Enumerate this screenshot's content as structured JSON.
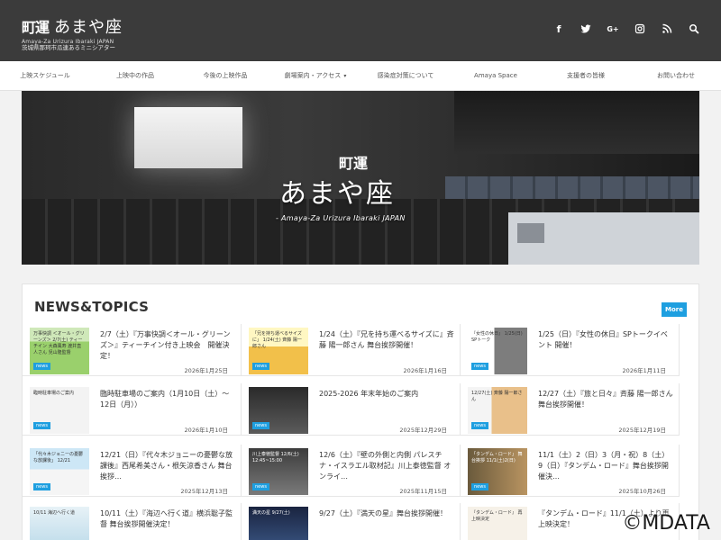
{
  "header": {
    "logo_mark": "町運",
    "logo_name": "あまや座",
    "logo_sub": "Amaya-Za Urizura Ibaraki JAPAN",
    "tagline": "茨城県那珂市瓜連あるミニシアター",
    "social_icons": [
      "facebook-icon",
      "twitter-icon",
      "google-plus-icon",
      "instagram-icon",
      "rss-icon",
      "search-icon"
    ]
  },
  "nav": {
    "items": [
      {
        "label": "上映スケジュール"
      },
      {
        "label": "上映中の作品"
      },
      {
        "label": "今後の上映作品"
      },
      {
        "label": "劇場案内・アクセス",
        "caret": "▾"
      },
      {
        "label": "感染症対策について"
      },
      {
        "label": "Amaya Space"
      },
      {
        "label": "支援者の皆様"
      },
      {
        "label": "お問い合わせ"
      }
    ]
  },
  "hero": {
    "mark": "町運",
    "name": "あまや座",
    "sub": "- Amaya-Za Urizura Ibaraki JAPAN"
  },
  "news": {
    "title": "NEWS&TOPICS",
    "more_label": "More",
    "tag_label": "news",
    "items": [
      {
        "title": "2/7（土）『万事快調＜オール・グリーンズ＞』ティーチイン付き上映会　開催決定！",
        "date": "2026年1月25日",
        "thumb_text": "万事快調 ＜オール・グリーンズ＞ 2/7(土) ティーチイン 大森風寿 渡井直人さん 児山隆監督"
      },
      {
        "title": "1/24（土）『兄を持ち運べるサイズに』斉藤 陽一郎さん 舞台挨拶開催！",
        "date": "2026年1月16日",
        "thumb_text": "「兄を持ち運べるサイズに」 1/24(土) 斉藤 陽一郎さん"
      },
      {
        "title": "1/25（日）『女性の休日』SPトークイベント 開催！",
        "date": "2026年1月11日",
        "thumb_text": "『女性の休日』 1/25(日) SPトーク"
      },
      {
        "title": "臨時駐車場のご案内（1月10日（土）～12日（月））",
        "date": "2026年1月10日",
        "thumb_text": "臨時駐車場のご案内"
      },
      {
        "title": "2025-2026 年末年始のご案内",
        "date": "2025年12月29日",
        "thumb_text": ""
      },
      {
        "title": "12/27（土）『旅と日々』斉藤 陽一郎さん 舞台挨拶開催！",
        "date": "2025年12月19日",
        "thumb_text": "12/27(土) 斉藤 陽一郎さん"
      },
      {
        "title": "12/21（日）『代々木ジョニーの憂鬱な放課後』西尾希美さん・根矢涼香さん 舞台挨拶…",
        "date": "2025年12月13日",
        "thumb_text": "「代々木ジョニーの憂鬱な放課後」 12/21"
      },
      {
        "title": "12/6（土）『壁の外側と内側 パレスチナ・イスラエル取材記』川上泰徳監督 オンライ…",
        "date": "2025年11月15日",
        "thumb_text": "川上泰徳監督 12/6(土) 12:45~15:00"
      },
      {
        "title": "11/1（土）2（日）3（月・祝）8（土）9（日）『タンデム・ロード』舞台挨拶開催決…",
        "date": "2025年10月26日",
        "thumb_text": "「タンデム・ロード」 舞台挨拶 11/1(土)2(日)"
      },
      {
        "title": "10/11（土）『海辺へ行く道』横浜聡子監督 舞台挨拶開催決定！",
        "date": "",
        "thumb_text": "10/11 海辺へ行く道"
      },
      {
        "title": "9/27（土）『満天の星』舞台挨拶開催！",
        "date": "",
        "thumb_text": "満天の星 9/27(土)"
      },
      {
        "title": "『タンデム・ロード』11/1（土）より再上映決定！",
        "date": "",
        "thumb_text": "『タンデム・ロード』 再上映決定"
      }
    ]
  },
  "watermark": "©MDATA"
}
